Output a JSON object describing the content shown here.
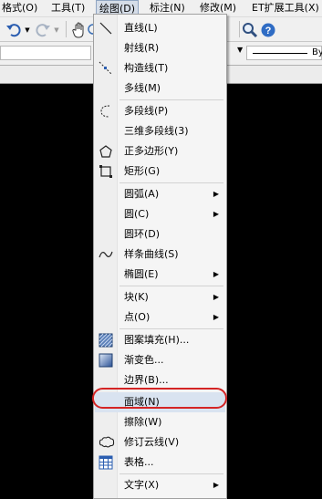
{
  "menubar": {
    "items": [
      {
        "label": "格式(O)"
      },
      {
        "label": "工具(T)"
      },
      {
        "label": "绘图(D)"
      },
      {
        "label": "标注(N)"
      },
      {
        "label": "修改(M)"
      },
      {
        "label": "ET扩展工具(X)"
      }
    ]
  },
  "toolbar": {
    "icons": [
      "undo-icon",
      "redo-icon",
      "pan-hand-icon",
      "zoom-icon",
      "help-icon"
    ]
  },
  "toolbar2": {
    "linetype_label": "By"
  },
  "menu": {
    "items": [
      {
        "label": "直线(L)",
        "icon": "line-icon"
      },
      {
        "label": "射线(R)",
        "icon": ""
      },
      {
        "label": "构造线(T)",
        "icon": "construction-line-icon"
      },
      {
        "label": "多线(M)",
        "icon": ""
      },
      {
        "label": "多段线(P)",
        "icon": "polyline-icon"
      },
      {
        "label": "三维多段线(3)",
        "icon": ""
      },
      {
        "label": "正多边形(Y)",
        "icon": "polygon-icon"
      },
      {
        "label": "矩形(G)",
        "icon": "rectangle-icon"
      },
      {
        "label": "圆弧(A)",
        "icon": "",
        "submenu": true
      },
      {
        "label": "圆(C)",
        "icon": "",
        "submenu": true
      },
      {
        "label": "圆环(D)",
        "icon": ""
      },
      {
        "label": "样条曲线(S)",
        "icon": "spline-icon"
      },
      {
        "label": "椭圆(E)",
        "icon": "",
        "submenu": true
      },
      {
        "label": "块(K)",
        "icon": "",
        "submenu": true
      },
      {
        "label": "点(O)",
        "icon": "",
        "submenu": true
      },
      {
        "label": "图案填充(H)...",
        "icon": "hatch-icon"
      },
      {
        "label": "渐变色...",
        "icon": "gradient-icon"
      },
      {
        "label": "边界(B)...",
        "icon": ""
      },
      {
        "label": "面域(N)",
        "icon": "",
        "highlighted": true
      },
      {
        "label": "擦除(W)",
        "icon": ""
      },
      {
        "label": "修订云线(V)",
        "icon": "revcloud-icon"
      },
      {
        "label": "表格...",
        "icon": "table-icon"
      },
      {
        "label": "文字(X)",
        "icon": "",
        "submenu": true
      }
    ]
  },
  "colors": {
    "highlight_ring": "#d42424",
    "canvas": "#000000"
  }
}
